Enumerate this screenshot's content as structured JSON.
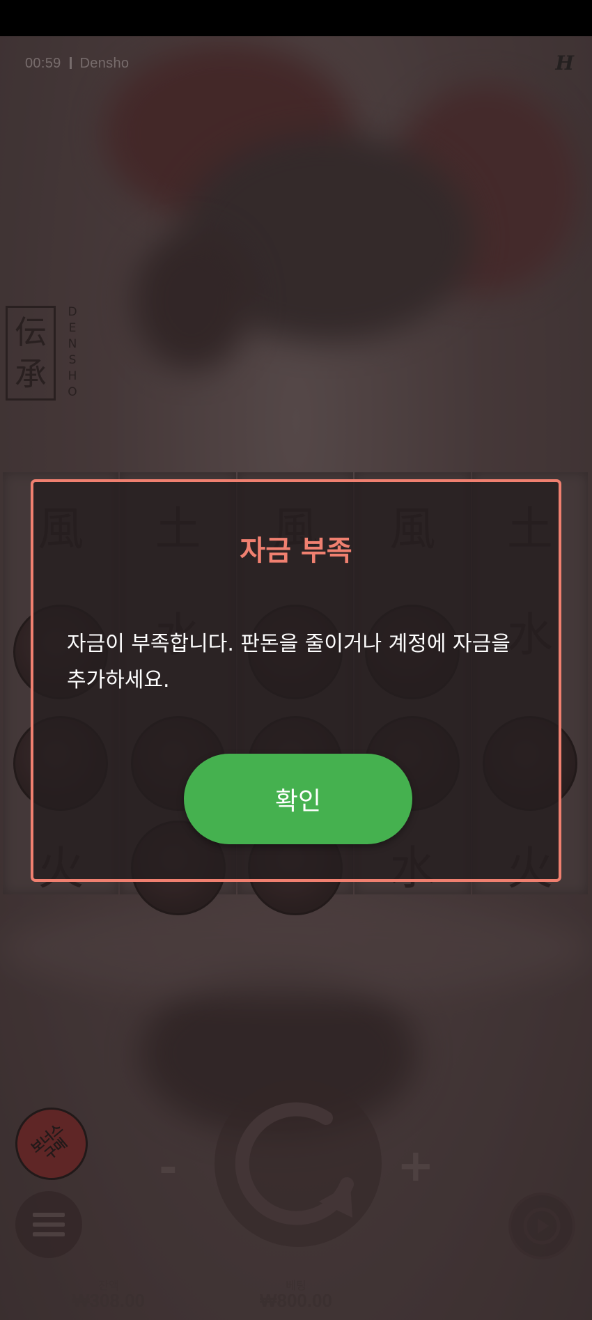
{
  "status_bar": {
    "time": "00:59",
    "game_name": "Densho"
  },
  "brand": {
    "mark": "H"
  },
  "logo": {
    "kanji": [
      "伝",
      "承"
    ],
    "vertical_text": [
      "D",
      "E",
      "N",
      "S",
      "H",
      "O"
    ]
  },
  "reels": [
    [
      "風",
      "coin",
      "coin",
      "火"
    ],
    [
      "土",
      "水",
      "coin",
      "coin"
    ],
    [
      "風",
      "coin",
      "coin",
      "coin"
    ],
    [
      "風",
      "coin",
      "coin",
      "水"
    ],
    [
      "土",
      "水",
      "coin",
      "火"
    ]
  ],
  "dialog": {
    "title": "자금 부족",
    "message": "자금이 부족합니다. 판돈을 줄이거나 계정에 자금을 추가하세요.",
    "ok_label": "확인"
  },
  "controls": {
    "bonus_label": "보너스 구매",
    "minus_label": "-",
    "plus_label": "+"
  },
  "footer": {
    "balance_label": "잔액",
    "balance_value": "₩308.00",
    "bet_label": "베팅",
    "bet_value": "₩800.00"
  },
  "colors": {
    "dialog_accent": "#f08070",
    "ok_button": "#45b14f"
  }
}
